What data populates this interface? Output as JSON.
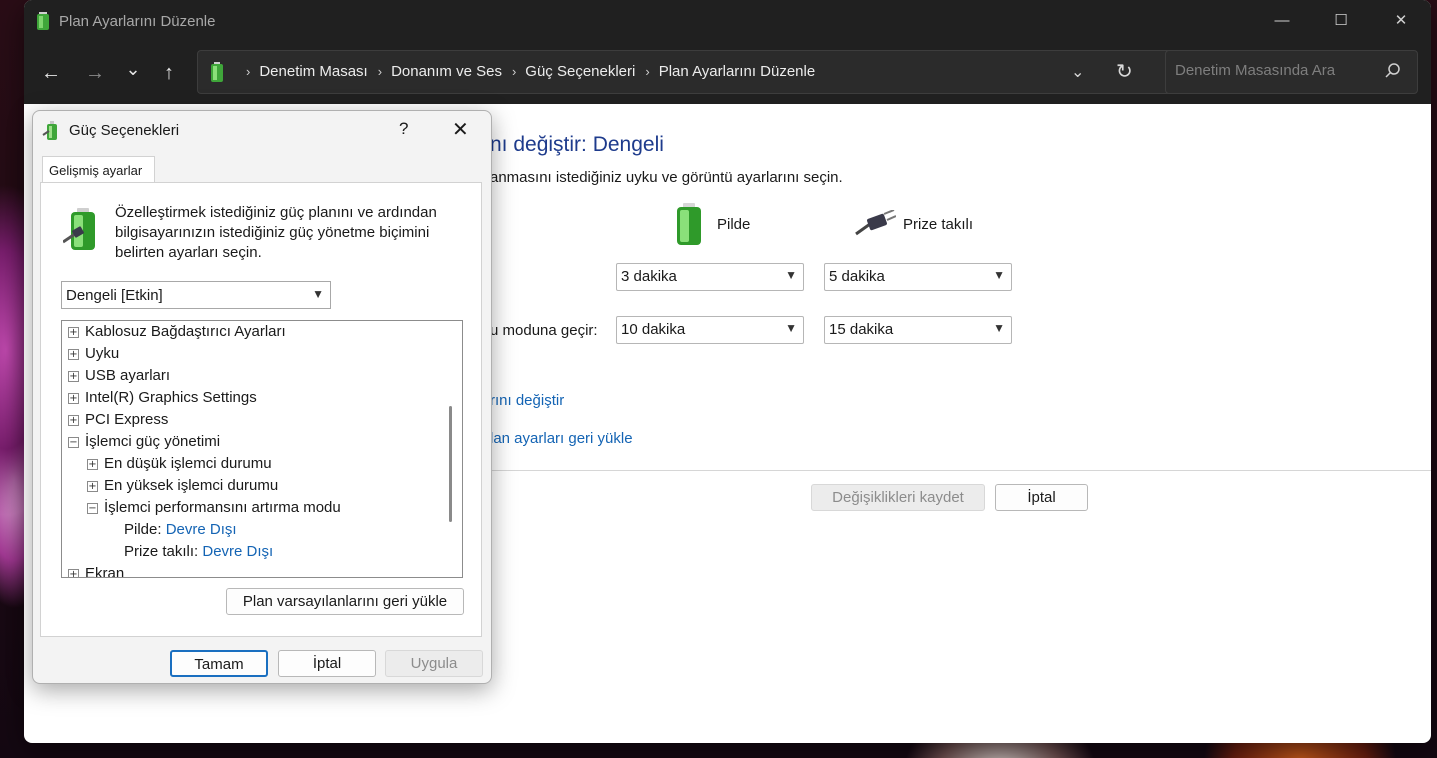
{
  "window": {
    "title": "Plan Ayarlarını Düzenle",
    "minimize": "—",
    "maximize": "☐",
    "close": "✕"
  },
  "nav": {
    "back": "←",
    "forward": "→",
    "recent": "⌄",
    "up": "↑",
    "breadcrumbs": [
      "Denetim Masası",
      "Donanım ve Ses",
      "Güç Seçenekleri",
      "Plan Ayarlarını Düzenle"
    ],
    "separator": "›",
    "dropdown": "⌄",
    "refresh": "↻",
    "search_placeholder": "Denetim Masasında Ara"
  },
  "plan_page": {
    "title": "nı değiştir: Dengeli",
    "description": "anmasını istediğiniz uyku ve görüntü ayarlarını seçin.",
    "col_battery": "Pilde",
    "col_plugged": "Prize takılı",
    "row2_label": "u moduna geçir:",
    "row1_battery": "3 dakika",
    "row1_plugged": "5 dakika",
    "row2_battery": "10 dakika",
    "row2_plugged": "15 dakika",
    "link_advanced": "rını değiştir",
    "link_restore": "lan ayarları geri yükle",
    "save_button": "Değişiklikleri kaydet",
    "cancel_button": "İptal"
  },
  "dialog": {
    "title": "Güç Seçenekleri",
    "help": "?",
    "close": "✕",
    "tab": "Gelişmiş ayarlar",
    "intro": "Özelleştirmek istediğiniz güç planını ve ardından bilgisayarınızın istediğiniz güç yönetme biçimini belirten ayarları seçin.",
    "plan_selected": "Dengeli [Etkin]",
    "tree": [
      {
        "label": "Kablosuz Bağdaştırıcı Ayarları",
        "expander": "+"
      },
      {
        "label": "Uyku",
        "expander": "+"
      },
      {
        "label": "USB ayarları",
        "expander": "+"
      },
      {
        "label": "Intel(R) Graphics Settings",
        "expander": "+"
      },
      {
        "label": "PCI Express",
        "expander": "+"
      },
      {
        "label": "İşlemci güç yönetimi",
        "expander": "−"
      },
      {
        "label": "En düşük işlemci durumu",
        "expander": "+"
      },
      {
        "label": "En yüksek işlemci durumu",
        "expander": "+"
      },
      {
        "label": "İşlemci performansını artırma modu",
        "expander": "−"
      },
      {
        "label": "Pilde:",
        "value": "Devre Dışı"
      },
      {
        "label": "Prize takılı:",
        "value": "Devre Dışı"
      },
      {
        "label": "Ekran",
        "expander": "+"
      }
    ],
    "restore_button": "Plan varsayılanlarını geri yükle",
    "ok_button": "Tamam",
    "cancel_button": "İptal",
    "apply_button": "Uygula"
  }
}
